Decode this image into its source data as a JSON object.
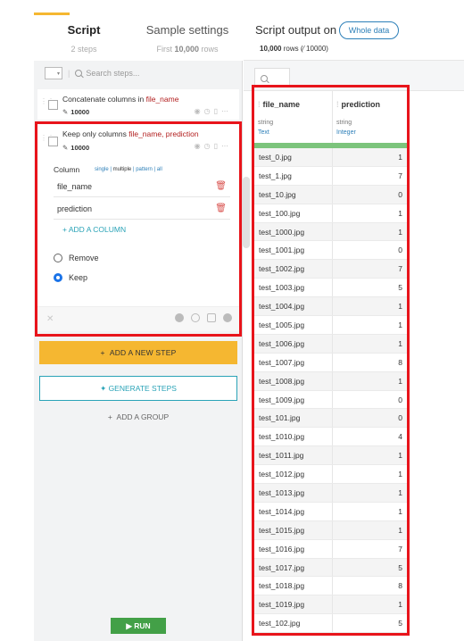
{
  "left": {
    "tabs": {
      "script": {
        "label": "Script",
        "sub": "2 steps"
      },
      "sample": {
        "label": "Sample settings",
        "sub_prefix": "First",
        "sub_rows": "10,000",
        "sub_suffix": "rows"
      }
    },
    "search": {
      "placeholder": "Search steps..."
    },
    "steps": [
      {
        "title_prefix": "Concatenate columns in",
        "title_col": "file_name",
        "count": "10000"
      },
      {
        "title_prefix": "Keep only columns",
        "title_col": "file_name, prediction",
        "count": "10000",
        "column_label": "Column",
        "modes": {
          "single": "single",
          "multiple": "multiple",
          "pattern": "pattern",
          "all": "all"
        },
        "columns": [
          "file_name",
          "prediction"
        ],
        "add_column": "ADD A COLUMN",
        "radio_remove": "Remove",
        "radio_keep": "Keep"
      }
    ],
    "buttons": {
      "add_step": "ADD A NEW STEP",
      "generate": "GENERATE STEPS",
      "add_group": "ADD A GROUP",
      "run": "RUN"
    }
  },
  "right": {
    "title": "Script output on",
    "whole_data": "Whole data",
    "rows_text": "10,000",
    "rows_suffix": "rows",
    "rows_count": "(⁄ 10000)",
    "columns": [
      {
        "name": "file_name",
        "type": "string",
        "meaning": "Text"
      },
      {
        "name": "prediction",
        "type": "string",
        "meaning": "Integer"
      }
    ],
    "rows": [
      [
        "test_0.jpg",
        "1"
      ],
      [
        "test_1.jpg",
        "7"
      ],
      [
        "test_10.jpg",
        "0"
      ],
      [
        "test_100.jpg",
        "1"
      ],
      [
        "test_1000.jpg",
        "1"
      ],
      [
        "test_1001.jpg",
        "0"
      ],
      [
        "test_1002.jpg",
        "7"
      ],
      [
        "test_1003.jpg",
        "5"
      ],
      [
        "test_1004.jpg",
        "1"
      ],
      [
        "test_1005.jpg",
        "1"
      ],
      [
        "test_1006.jpg",
        "1"
      ],
      [
        "test_1007.jpg",
        "8"
      ],
      [
        "test_1008.jpg",
        "1"
      ],
      [
        "test_1009.jpg",
        "0"
      ],
      [
        "test_101.jpg",
        "0"
      ],
      [
        "test_1010.jpg",
        "4"
      ],
      [
        "test_1011.jpg",
        "1"
      ],
      [
        "test_1012.jpg",
        "1"
      ],
      [
        "test_1013.jpg",
        "1"
      ],
      [
        "test_1014.jpg",
        "1"
      ],
      [
        "test_1015.jpg",
        "1"
      ],
      [
        "test_1016.jpg",
        "7"
      ],
      [
        "test_1017.jpg",
        "5"
      ],
      [
        "test_1018.jpg",
        "8"
      ],
      [
        "test_1019.jpg",
        "1"
      ],
      [
        "test_102.jpg",
        "5"
      ]
    ]
  },
  "colors": {
    "accent": "#f5b731",
    "teal": "#2aa3b7",
    "highlight": "#e8141b",
    "quality_bar": "#7cc47c"
  }
}
